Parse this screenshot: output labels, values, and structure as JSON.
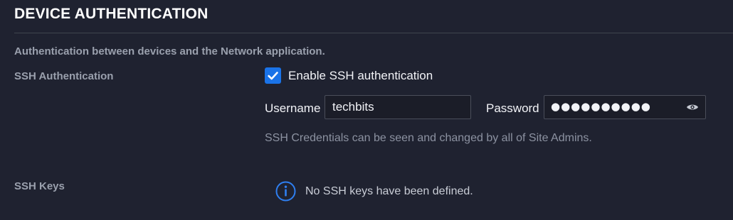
{
  "section": {
    "title": "DEVICE AUTHENTICATION",
    "description": "Authentication between devices and the Network application."
  },
  "ssh_auth": {
    "label": "SSH Authentication",
    "checkbox_label": "Enable SSH authentication",
    "checked": true,
    "username_label": "Username",
    "username_value": "techbits",
    "password_label": "Password",
    "password_masked": "●●●●●●●●●●",
    "helper_text": "SSH Credentials can be seen and changed by all of Site Admins."
  },
  "ssh_keys": {
    "label": "SSH Keys",
    "empty_message": "No SSH keys have been defined."
  },
  "icons": {
    "checkbox": "checkmark-icon",
    "password_toggle": "eye-icon",
    "info": "info-circle-icon"
  },
  "colors": {
    "background": "#1f2230",
    "accent": "#1a73e8",
    "muted_text": "#9aa0ad"
  }
}
